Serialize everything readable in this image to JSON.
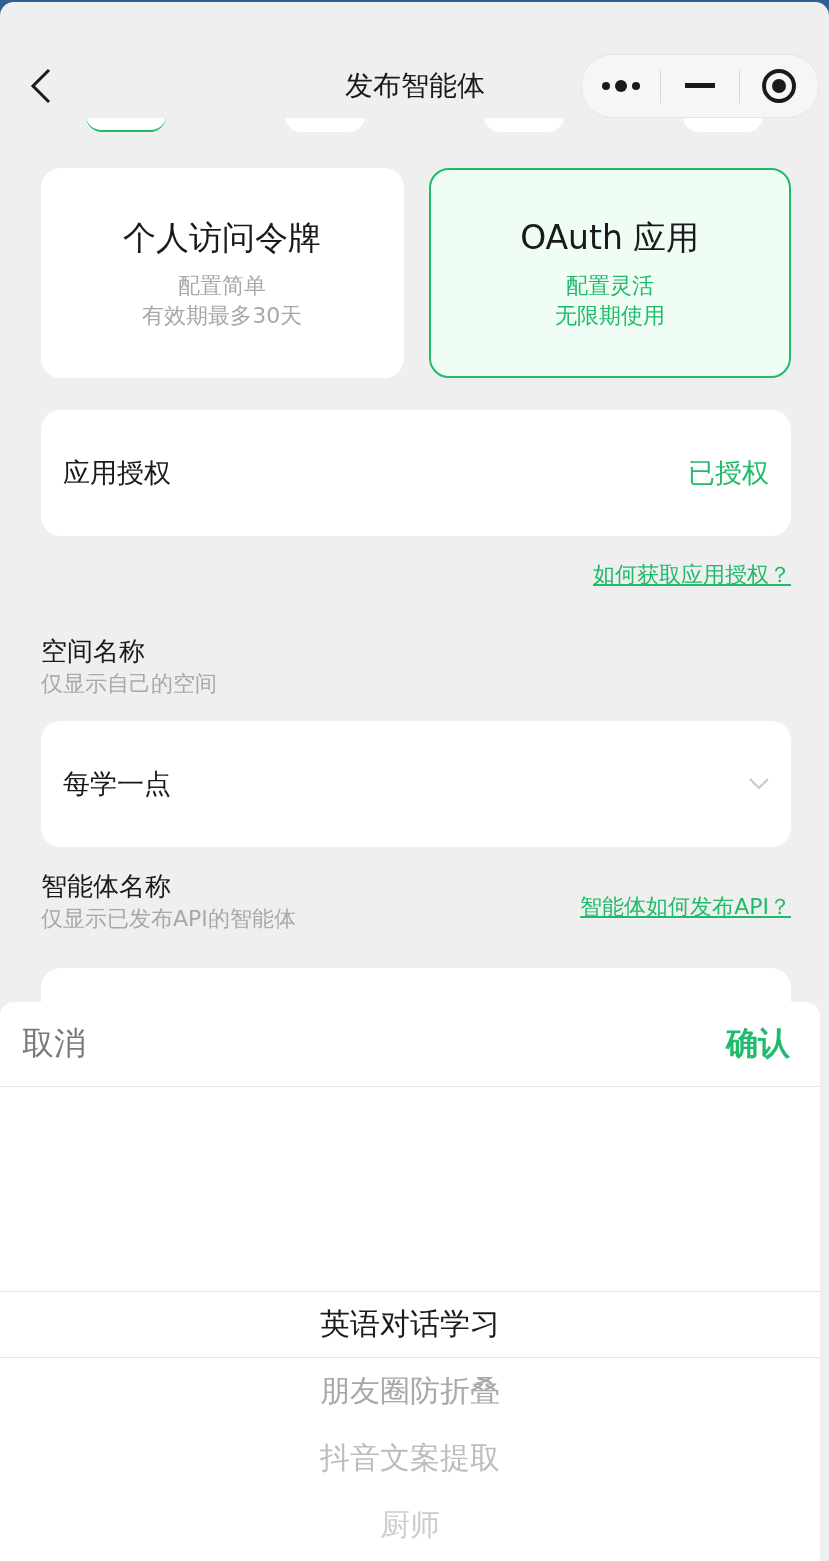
{
  "nav": {
    "title": "发布智能体"
  },
  "steps": [
    {
      "selected": true
    },
    {
      "selected": false
    },
    {
      "selected": false
    },
    {
      "selected": false
    }
  ],
  "auth_types": [
    {
      "title": "个人访问令牌",
      "lines": [
        "配置简单",
        "有效期最多30天"
      ],
      "selected": false
    },
    {
      "title": "OAuth 应用",
      "lines": [
        "配置灵活",
        "无限期使用"
      ],
      "selected": true
    }
  ],
  "authorization": {
    "label": "应用授权",
    "status": "已授权",
    "help_link": "如何获取应用授权？"
  },
  "space": {
    "label": "空间名称",
    "hint": "仅显示自己的空间",
    "value": "每学一点"
  },
  "agent": {
    "label": "智能体名称",
    "hint": "仅显示已发布API的智能体",
    "help_link": "智能体如何发布API？"
  },
  "picker": {
    "cancel": "取消",
    "confirm": "确认",
    "options": [
      {
        "label": "英语对话学习",
        "selected": true
      },
      {
        "label": "朋友圈防折叠",
        "selected": false
      },
      {
        "label": "抖音文案提取",
        "selected": false
      },
      {
        "label": "厨师",
        "selected": false
      }
    ]
  }
}
